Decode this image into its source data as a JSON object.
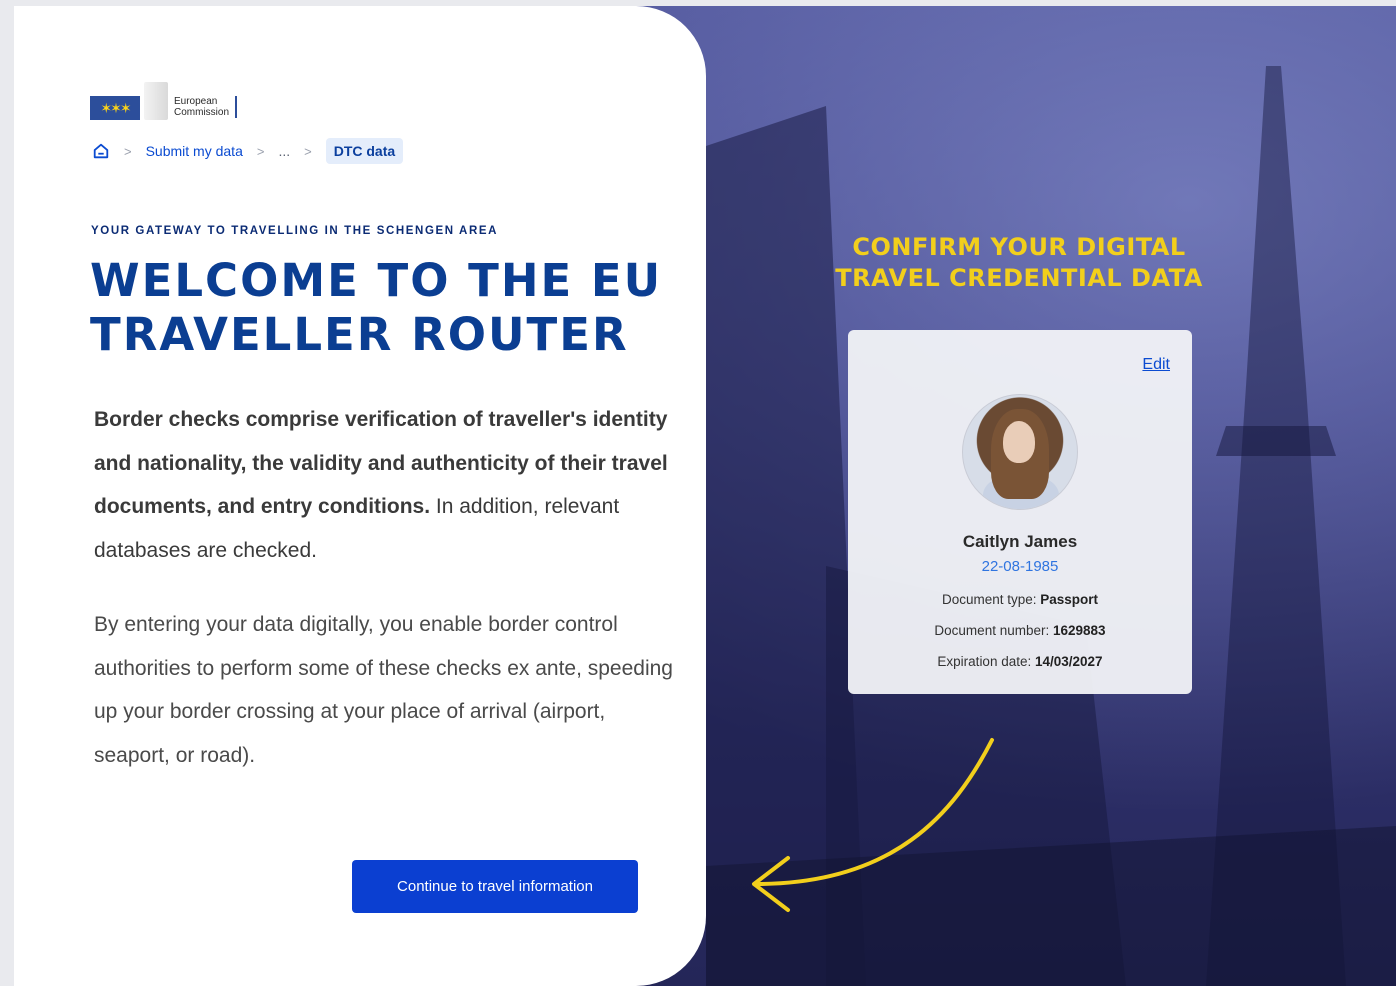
{
  "logo": {
    "flag_stars": "✶✶✶",
    "line1": "European",
    "line2": "Commission"
  },
  "breadcrumb": {
    "item1": "Submit my data",
    "ellipsis": "...",
    "current": "DTC data"
  },
  "hero": {
    "eyebrow": "YOUR GATEWAY TO TRAVELLING IN THE SCHENGEN AREA",
    "title_line1": "WELCOME TO THE EU",
    "title_line2": "TRAVELLER ROUTER",
    "para1_bold": "Border checks comprise verification of traveller's identity and nationality, the validity and authenticity of their travel documents, and entry conditions.",
    "para1_rest": " In addition, relevant databases are checked.",
    "para2": "By entering your data digitally, you enable border control authorities to perform some of these checks ex ante, speeding up your border crossing at your place of arrival (airport, seaport, or road).",
    "cta_label": "Continue to travel information"
  },
  "credential": {
    "heading_line1": "CONFIRM YOUR DIGITAL",
    "heading_line2": "TRAVEL CREDENTIAL DATA",
    "edit_label": "Edit",
    "name": "Caitlyn James",
    "dob": "22-08-1985",
    "doc_type_label": "Document type:",
    "doc_type_value": "Passport",
    "doc_number_label": "Document number:",
    "doc_number_value": "1629883",
    "expiry_label": "Expiration date:",
    "expiry_value": "14/03/2027"
  },
  "colors": {
    "primary": "#0b3fd1",
    "title": "#0b3e92",
    "accent_yellow": "#f2cf1c",
    "background_purple": "#3d3f7e"
  }
}
